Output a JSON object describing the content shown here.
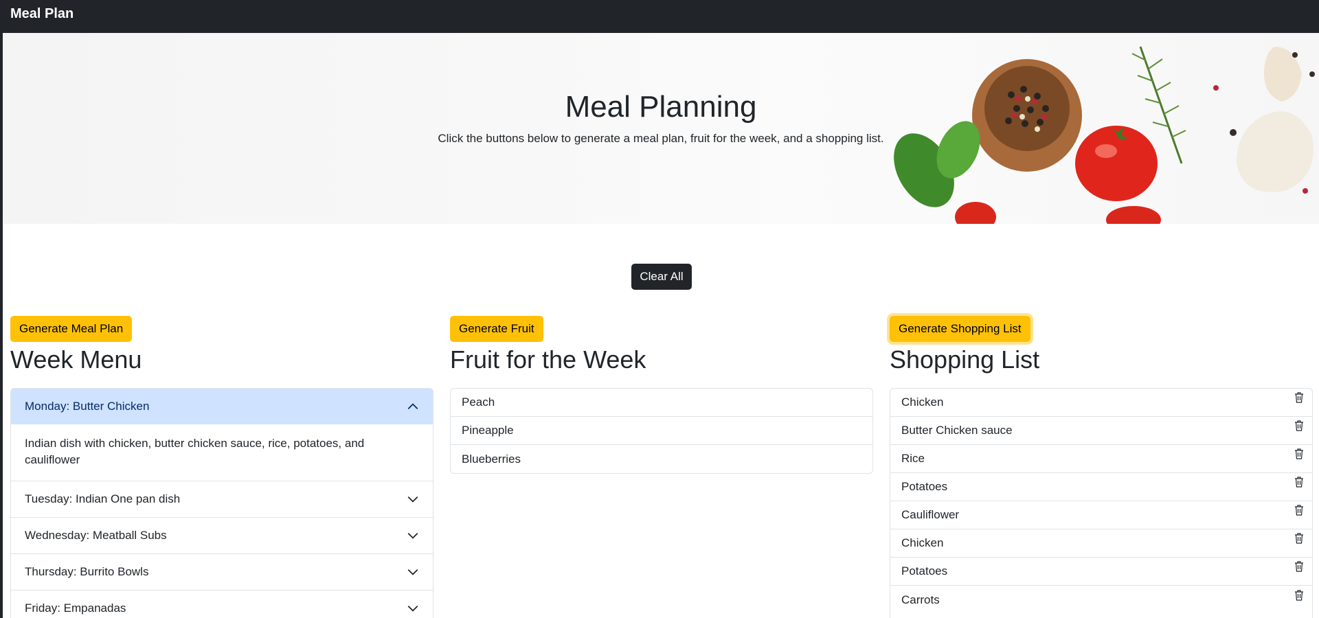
{
  "navbar": {
    "brand": "Meal Plan"
  },
  "hero": {
    "title": "Meal Planning",
    "subtitle": "Click the buttons below to generate a meal plan, fruit for the week, and a shopping list."
  },
  "actions": {
    "clear_all": "Clear All"
  },
  "week_menu": {
    "button": "Generate Meal Plan",
    "title": "Week Menu",
    "items": [
      {
        "label": "Monday: Butter Chicken",
        "body": "Indian dish with chicken, butter chicken sauce, rice, potatoes, and cauliflower",
        "expanded": true
      },
      {
        "label": "Tuesday: Indian One pan dish",
        "expanded": false
      },
      {
        "label": "Wednesday: Meatball Subs",
        "expanded": false
      },
      {
        "label": "Thursday: Burrito Bowls",
        "expanded": false
      },
      {
        "label": "Friday: Empanadas",
        "expanded": false
      }
    ]
  },
  "fruit": {
    "button": "Generate Fruit",
    "title": "Fruit for the Week",
    "items": [
      "Peach",
      "Pineapple",
      "Blueberries"
    ]
  },
  "shopping": {
    "button": "Generate Shopping List",
    "title": "Shopping List",
    "items": [
      "Chicken",
      "Butter Chicken sauce",
      "Rice",
      "Potatoes",
      "Cauliflower",
      "Chicken",
      "Potatoes",
      "Carrots"
    ],
    "item_icon": "trash-icon"
  },
  "colors": {
    "navbar": "#212529",
    "warning": "#ffc107",
    "accordion_active": "#cfe2ff",
    "border": "#dee2e6"
  }
}
